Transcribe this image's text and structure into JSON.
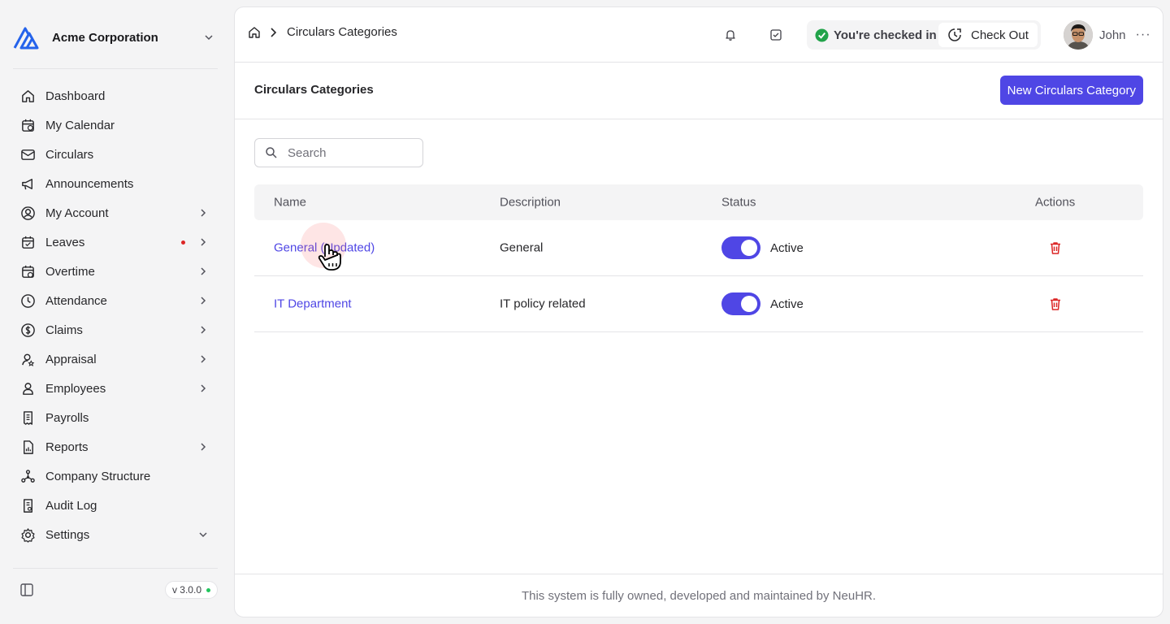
{
  "sidebar": {
    "company": "Acme Corporation",
    "items": [
      {
        "label": "Dashboard",
        "icon": "home-icon"
      },
      {
        "label": "My Calendar",
        "icon": "calendar-icon"
      },
      {
        "label": "Circulars",
        "icon": "mail-icon"
      },
      {
        "label": "Announcements",
        "icon": "megaphone-icon"
      },
      {
        "label": "My Account",
        "icon": "user-circle-icon"
      },
      {
        "label": "Leaves",
        "icon": "calendar-check-icon"
      },
      {
        "label": "Overtime",
        "icon": "calendar-clock-icon"
      },
      {
        "label": "Attendance",
        "icon": "clock-icon"
      },
      {
        "label": "Claims",
        "icon": "dollar-circle-icon"
      },
      {
        "label": "Appraisal",
        "icon": "user-star-icon"
      },
      {
        "label": "Employees",
        "icon": "user-icon"
      },
      {
        "label": "Payrolls",
        "icon": "receipt-icon"
      },
      {
        "label": "Reports",
        "icon": "report-icon"
      },
      {
        "label": "Company Structure",
        "icon": "hierarchy-icon"
      },
      {
        "label": "Audit Log",
        "icon": "audit-icon"
      },
      {
        "label": "Settings",
        "icon": "gear-icon"
      }
    ],
    "version": "v 3.0.0"
  },
  "topbar": {
    "breadcrumb": "Circulars Categories",
    "checkin_status": "You're checked in",
    "checkout_label": "Check Out",
    "user_name": "John",
    "more": "···"
  },
  "page": {
    "title": "Circulars Categories",
    "new_button": "New Circulars Category",
    "search_placeholder": "Search"
  },
  "table": {
    "headers": {
      "name": "Name",
      "description": "Description",
      "status": "Status",
      "actions": "Actions"
    },
    "rows": [
      {
        "name": "General (Updated)",
        "description": "General",
        "status": "Active",
        "enabled": true
      },
      {
        "name": "IT Department",
        "description": "IT policy related",
        "status": "Active",
        "enabled": true
      }
    ]
  },
  "footer": "This system is fully owned, developed and maintained by NeuHR.",
  "colors": {
    "accent": "#4f46e5",
    "danger": "#dc2626",
    "success": "#22a34a"
  }
}
